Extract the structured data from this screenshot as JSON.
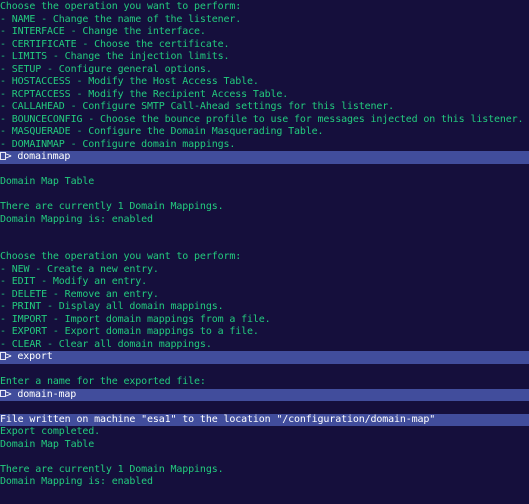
{
  "terminal": {
    "title": "Cisco ESA CLI - listenerconfig domainmap export",
    "background_color": "#150f3c",
    "text_color": "#23cb7e",
    "highlight_background_color": "#414d9c",
    "highlight_text_color": "#ffffff",
    "prompt_glyph": "missing-glyph-box",
    "prompt_marker": "> "
  },
  "lines": [
    {
      "text": "Choose the operation you want to perform:",
      "highlight": false,
      "prompt": false,
      "name": "menu-header-listener"
    },
    {
      "text": "- NAME - Change the name of the listener.",
      "highlight": false,
      "prompt": false,
      "name": "menu-option-name"
    },
    {
      "text": "- INTERFACE - Change the interface.",
      "highlight": false,
      "prompt": false,
      "name": "menu-option-interface"
    },
    {
      "text": "- CERTIFICATE - Choose the certificate.",
      "highlight": false,
      "prompt": false,
      "name": "menu-option-certificate"
    },
    {
      "text": "- LIMITS - Change the injection limits.",
      "highlight": false,
      "prompt": false,
      "name": "menu-option-limits"
    },
    {
      "text": "- SETUP - Configure general options.",
      "highlight": false,
      "prompt": false,
      "name": "menu-option-setup"
    },
    {
      "text": "- HOSTACCESS - Modify the Host Access Table.",
      "highlight": false,
      "prompt": false,
      "name": "menu-option-hostaccess"
    },
    {
      "text": "- RCPTACCESS - Modify the Recipient Access Table.",
      "highlight": false,
      "prompt": false,
      "name": "menu-option-rcptaccess"
    },
    {
      "text": "- CALLAHEAD - Configure SMTP Call-Ahead settings for this listener.",
      "highlight": false,
      "prompt": false,
      "name": "menu-option-callahead"
    },
    {
      "text": "- BOUNCECONFIG - Choose the bounce profile to use for messages injected on this listener.",
      "highlight": false,
      "prompt": false,
      "name": "menu-option-bounceconfig"
    },
    {
      "text": "- MASQUERADE - Configure the Domain Masquerading Table.",
      "highlight": false,
      "prompt": false,
      "name": "menu-option-masquerade"
    },
    {
      "text": "- DOMAINMAP - Configure domain mappings.",
      "highlight": false,
      "prompt": false,
      "name": "menu-option-domainmap"
    },
    {
      "text": "domainmap",
      "highlight": true,
      "prompt": true,
      "name": "prompt-input-domainmap"
    },
    {
      "text": "",
      "highlight": false,
      "prompt": false,
      "name": "blank-line"
    },
    {
      "text": "Domain Map Table",
      "highlight": false,
      "prompt": false,
      "name": "output-domain-map-table-heading"
    },
    {
      "text": "",
      "highlight": false,
      "prompt": false,
      "name": "blank-line"
    },
    {
      "text": "There are currently 1 Domain Mappings.",
      "highlight": false,
      "prompt": false,
      "name": "output-mapping-count"
    },
    {
      "text": "Domain Mapping is: enabled",
      "highlight": false,
      "prompt": false,
      "name": "output-mapping-status"
    },
    {
      "text": "",
      "highlight": false,
      "prompt": false,
      "name": "blank-line"
    },
    {
      "text": "",
      "highlight": false,
      "prompt": false,
      "name": "blank-line"
    },
    {
      "text": "Choose the operation you want to perform:",
      "highlight": false,
      "prompt": false,
      "name": "menu-header-domainmap"
    },
    {
      "text": "- NEW - Create a new entry.",
      "highlight": false,
      "prompt": false,
      "name": "menu-option-new"
    },
    {
      "text": "- EDIT - Modify an entry.",
      "highlight": false,
      "prompt": false,
      "name": "menu-option-edit"
    },
    {
      "text": "- DELETE - Remove an entry.",
      "highlight": false,
      "prompt": false,
      "name": "menu-option-delete"
    },
    {
      "text": "- PRINT - Display all domain mappings.",
      "highlight": false,
      "prompt": false,
      "name": "menu-option-print"
    },
    {
      "text": "- IMPORT - Import domain mappings from a file.",
      "highlight": false,
      "prompt": false,
      "name": "menu-option-import"
    },
    {
      "text": "- EXPORT - Export domain mappings to a file.",
      "highlight": false,
      "prompt": false,
      "name": "menu-option-export"
    },
    {
      "text": "- CLEAR - Clear all domain mappings.",
      "highlight": false,
      "prompt": false,
      "name": "menu-option-clear"
    },
    {
      "text": "export",
      "highlight": true,
      "prompt": true,
      "name": "prompt-input-export"
    },
    {
      "text": "",
      "highlight": false,
      "prompt": false,
      "name": "blank-line"
    },
    {
      "text": "Enter a name for the exported file:",
      "highlight": false,
      "prompt": false,
      "name": "output-filename-request"
    },
    {
      "text": "domain-map",
      "highlight": true,
      "prompt": true,
      "name": "prompt-input-filename"
    },
    {
      "text": "",
      "highlight": false,
      "prompt": false,
      "name": "blank-line"
    },
    {
      "text": "File written on machine \"esa1\" to the location \"/configuration/domain-map\"",
      "highlight": true,
      "prompt": false,
      "name": "output-file-written"
    },
    {
      "text": "Export completed.",
      "highlight": false,
      "prompt": false,
      "name": "output-export-completed"
    },
    {
      "text": "Domain Map Table",
      "highlight": false,
      "prompt": false,
      "name": "output-domain-map-table-heading-2"
    },
    {
      "text": "",
      "highlight": false,
      "prompt": false,
      "name": "blank-line"
    },
    {
      "text": "There are currently 1 Domain Mappings.",
      "highlight": false,
      "prompt": false,
      "name": "output-mapping-count-2"
    },
    {
      "text": "Domain Mapping is: enabled",
      "highlight": false,
      "prompt": false,
      "name": "output-mapping-status-2"
    }
  ]
}
